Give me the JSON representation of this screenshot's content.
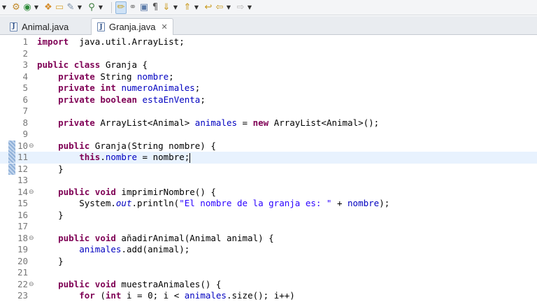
{
  "toolbar": {
    "icons": [
      "menu-dropdown-icon",
      "build-icon",
      "run-icon",
      "open-icon",
      "folder-icon",
      "task-icon",
      "search-icon",
      "highlight-icon",
      "toggle-icon",
      "block-select-icon",
      "pilcrow-icon",
      "next-annotation-icon",
      "prev-annotation-icon",
      "last-edit-icon",
      "back-icon",
      "forward-icon"
    ]
  },
  "tabs": [
    {
      "label": "Animal.java",
      "active": false
    },
    {
      "label": "Granja.java",
      "active": true
    }
  ],
  "editor": {
    "lines": [
      {
        "n": "1",
        "fold": "",
        "segs": [
          [
            "kw",
            "import"
          ],
          [
            "",
            "  java.util.ArrayList;"
          ]
        ]
      },
      {
        "n": "2",
        "fold": "",
        "segs": []
      },
      {
        "n": "3",
        "fold": "",
        "segs": [
          [
            "kw",
            "public"
          ],
          [
            "",
            " "
          ],
          [
            "kw",
            "class"
          ],
          [
            "",
            " Granja {"
          ]
        ]
      },
      {
        "n": "4",
        "fold": "",
        "segs": [
          [
            "",
            "    "
          ],
          [
            "kw",
            "private"
          ],
          [
            "",
            " String "
          ],
          [
            "fld",
            "nombre"
          ],
          [
            "",
            ";"
          ]
        ]
      },
      {
        "n": "5",
        "fold": "",
        "segs": [
          [
            "",
            "    "
          ],
          [
            "kw",
            "private"
          ],
          [
            "",
            " "
          ],
          [
            "kw",
            "int"
          ],
          [
            "",
            " "
          ],
          [
            "fld",
            "numeroAnimales"
          ],
          [
            "",
            ";"
          ]
        ]
      },
      {
        "n": "6",
        "fold": "",
        "segs": [
          [
            "",
            "    "
          ],
          [
            "kw",
            "private"
          ],
          [
            "",
            " "
          ],
          [
            "kw",
            "boolean"
          ],
          [
            "",
            " "
          ],
          [
            "fld",
            "estaEnVenta"
          ],
          [
            "",
            ";"
          ]
        ]
      },
      {
        "n": "7",
        "fold": "",
        "segs": []
      },
      {
        "n": "8",
        "fold": "",
        "segs": [
          [
            "",
            "    "
          ],
          [
            "kw",
            "private"
          ],
          [
            "",
            " ArrayList<Animal> "
          ],
          [
            "fld",
            "animales"
          ],
          [
            "",
            " = "
          ],
          [
            "kw",
            "new"
          ],
          [
            "",
            " ArrayList<Animal>();"
          ]
        ]
      },
      {
        "n": "9",
        "fold": "",
        "segs": []
      },
      {
        "n": "10",
        "fold": "⊖",
        "segs": [
          [
            "",
            "    "
          ],
          [
            "kw",
            "public"
          ],
          [
            "",
            " Granja(String nombre) {"
          ]
        ]
      },
      {
        "n": "11",
        "fold": "",
        "current": true,
        "segs": [
          [
            "",
            "        "
          ],
          [
            "kw",
            "this"
          ],
          [
            "",
            "."
          ],
          [
            "fld",
            "nombre"
          ],
          [
            "",
            " = nombre;"
          ]
        ]
      },
      {
        "n": "12",
        "fold": "",
        "segs": [
          [
            "",
            "    }"
          ]
        ]
      },
      {
        "n": "13",
        "fold": "",
        "segs": []
      },
      {
        "n": "14",
        "fold": "⊖",
        "segs": [
          [
            "",
            "    "
          ],
          [
            "kw",
            "public"
          ],
          [
            "",
            " "
          ],
          [
            "kw",
            "void"
          ],
          [
            "",
            " imprimirNombre() {"
          ]
        ]
      },
      {
        "n": "15",
        "fold": "",
        "segs": [
          [
            "",
            "        System."
          ],
          [
            "stat",
            "out"
          ],
          [
            "",
            ".println("
          ],
          [
            "str",
            "\"El nombre de la granja es: \""
          ],
          [
            "",
            " + "
          ],
          [
            "fld",
            "nombre"
          ],
          [
            "",
            ");"
          ]
        ]
      },
      {
        "n": "16",
        "fold": "",
        "segs": [
          [
            "",
            "    }"
          ]
        ]
      },
      {
        "n": "17",
        "fold": "",
        "segs": []
      },
      {
        "n": "18",
        "fold": "⊖",
        "segs": [
          [
            "",
            "    "
          ],
          [
            "kw",
            "public"
          ],
          [
            "",
            " "
          ],
          [
            "kw",
            "void"
          ],
          [
            "",
            " añadirAnimal(Animal animal) {"
          ]
        ]
      },
      {
        "n": "19",
        "fold": "",
        "segs": [
          [
            "",
            "        "
          ],
          [
            "fld",
            "animales"
          ],
          [
            "",
            ".add(animal);"
          ]
        ]
      },
      {
        "n": "20",
        "fold": "",
        "segs": [
          [
            "",
            "    }"
          ]
        ]
      },
      {
        "n": "21",
        "fold": "",
        "segs": []
      },
      {
        "n": "22",
        "fold": "⊖",
        "segs": [
          [
            "",
            "    "
          ],
          [
            "kw",
            "public"
          ],
          [
            "",
            " "
          ],
          [
            "kw",
            "void"
          ],
          [
            "",
            " muestraAnimales() {"
          ]
        ]
      },
      {
        "n": "23",
        "fold": "",
        "segs": [
          [
            "",
            "        "
          ],
          [
            "kw",
            "for"
          ],
          [
            "",
            " ("
          ],
          [
            "kw",
            "int"
          ],
          [
            "",
            " i = 0; i < "
          ],
          [
            "fld",
            "animales"
          ],
          [
            "",
            ".size(); i++)"
          ]
        ]
      }
    ]
  }
}
